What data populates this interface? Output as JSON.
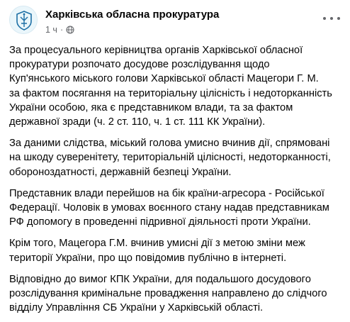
{
  "post": {
    "author": "Харківська обласна прокуратура",
    "time": "1 ч",
    "separator": "·",
    "paragraphs": [
      "За процесуального керівництва органів Харківської обласної\nпрокуратури розпочато досудове розслідування щодо\nКуп'янського міського голови Харківської області Мацегори Г. М.\nза фактом посягання на територіальну цілісність і недоторканність\nУкраїни особою, яка є представником влади, та за фактом\nдержавної зради (ч. 2 ст. 110, ч. 1 ст. 111 КК України).",
      "За даними слідства, міський голова умисно вчинив дії, спрямовані\nна шкоду суверенітету, територіальній цілісності, недоторканності,\nобороноздатності, державній  безпеці  України.",
      "Представник влади перейшов на бік країни-агресора - Російської\nФедерації. Чоловік в умовах воєнного стану надав представникам\nРФ допомогу в проведенні підривної діяльності проти України.",
      "Крім того, Мацегора Г.М. вчинив умисні дії з метою зміни меж\nтериторії України, про що повідомив публічно в інтернеті.",
      "Відповідно до вимог КПК України, для подальшого досудового\nрозслідування кримінальне провадження направлено до слідчого\nвідділу Управління СБ України у Харківській області."
    ]
  },
  "icons": {
    "avatar": "prosecutor-emblem-icon",
    "privacy": "globe-icon",
    "more": "more-options-icon"
  },
  "colors": {
    "text": "#050505",
    "secondary": "#65676b",
    "emblem": "#1d6fa5"
  }
}
